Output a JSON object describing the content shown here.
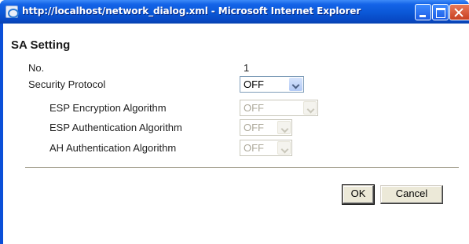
{
  "window": {
    "title": "http://localhost/network_dialog.xml - Microsoft Internet Explorer"
  },
  "dialog": {
    "heading": "SA Setting",
    "fields": [
      {
        "label": "No.",
        "value": "1"
      },
      {
        "label": "Security Protocol",
        "value": "OFF",
        "enabled": true
      },
      {
        "label": "ESP Encryption Algorithm",
        "value": "OFF",
        "enabled": false
      },
      {
        "label": "ESP Authentication Algorithm",
        "value": "OFF",
        "enabled": false
      },
      {
        "label": "AH Authentication Algorithm",
        "value": "OFF",
        "enabled": false
      }
    ],
    "buttons": {
      "ok": "OK",
      "cancel": "Cancel"
    }
  },
  "icons": [
    "ie-page-icon",
    "minimize-icon",
    "maximize-icon",
    "close-icon",
    "chevron-down-icon"
  ],
  "colors": {
    "titlebar": "#0a57d6",
    "disabled_text": "#aca899",
    "select_border": "#7f9db9"
  }
}
